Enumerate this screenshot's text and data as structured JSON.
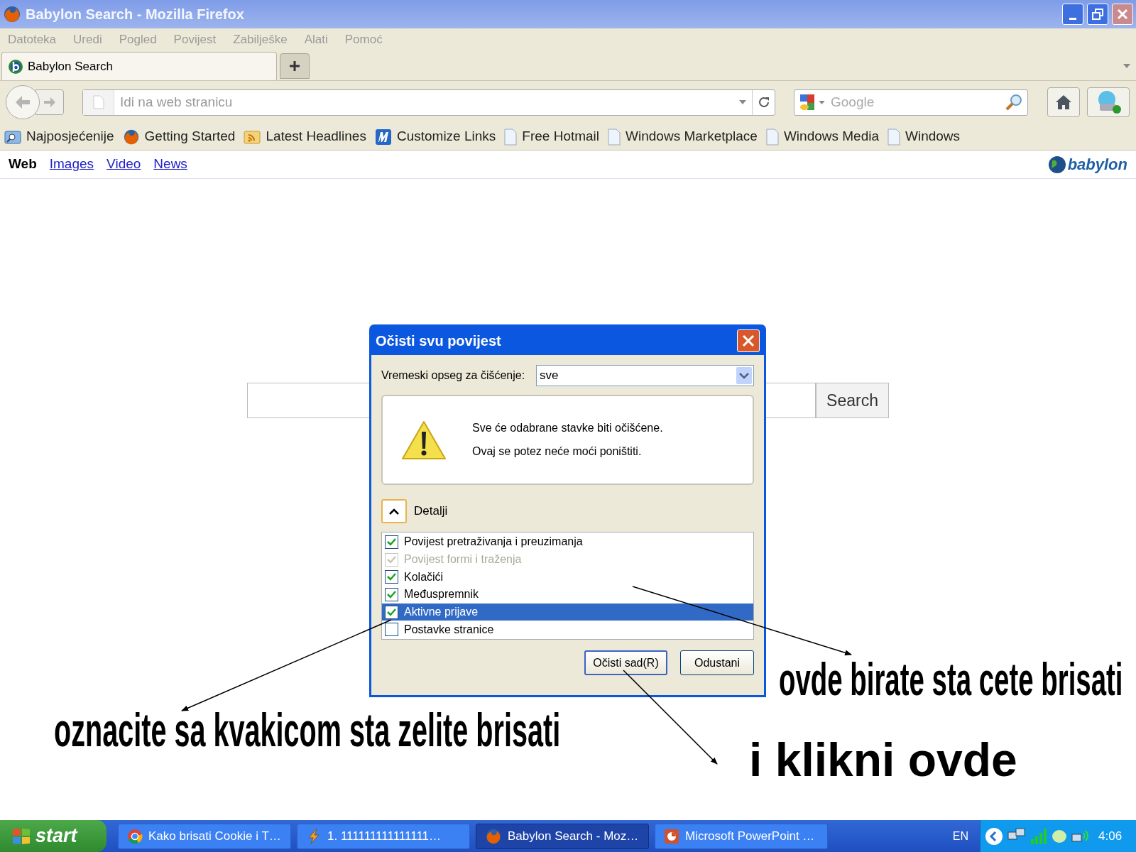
{
  "window": {
    "title": "Babylon Search - Mozilla Firefox"
  },
  "menu": [
    "Datoteka",
    "Uredi",
    "Pogled",
    "Povijest",
    "Zabilješke",
    "Alati",
    "Pomoć"
  ],
  "tabs": [
    {
      "label": "Babylon Search",
      "selected": true
    }
  ],
  "toolbar": {
    "address_placeholder": "Idi na web stranicu",
    "search_placeholder": "Google"
  },
  "bookmarks": [
    {
      "label": "Najposjećenije",
      "kind": "folder"
    },
    {
      "label": "Getting Started",
      "kind": "firefox"
    },
    {
      "label": "Latest Headlines",
      "kind": "feed"
    },
    {
      "label": "Customize Links",
      "kind": "m"
    },
    {
      "label": "Free Hotmail",
      "kind": "page"
    },
    {
      "label": "Windows Marketplace",
      "kind": "page"
    },
    {
      "label": "Windows Media",
      "kind": "page"
    },
    {
      "label": "Windows",
      "kind": "page"
    }
  ],
  "page_nav": [
    {
      "label": "Web",
      "selected": true
    },
    {
      "label": "Images",
      "selected": false
    },
    {
      "label": "Video",
      "selected": false
    },
    {
      "label": "News",
      "selected": false
    }
  ],
  "logo": "babylon",
  "search": {
    "button": "Search"
  },
  "dialog": {
    "title": "Očisti svu povijest",
    "range_label": "Vremeski opseg za čišćenje:",
    "range_value": "sve",
    "warning": [
      "Sve će odabrane stavke biti očišćene.",
      "Ovaj se potez neće moći poništiti."
    ],
    "details_label": "Detalji",
    "expanded": true,
    "items": [
      {
        "label": "Povijest pretraživanja i preuzimanja",
        "checked": true,
        "disabled": false,
        "selected": false
      },
      {
        "label": "Povijest formi i traženja",
        "checked": true,
        "disabled": true,
        "selected": false
      },
      {
        "label": "Kolačići",
        "checked": true,
        "disabled": false,
        "selected": false
      },
      {
        "label": "Međuspremnik",
        "checked": true,
        "disabled": false,
        "selected": false
      },
      {
        "label": "Aktivne prijave",
        "checked": true,
        "disabled": false,
        "selected": true
      },
      {
        "label": "Postavke stranice",
        "checked": false,
        "disabled": false,
        "selected": false
      }
    ],
    "buttons": [
      "Očisti sad(R)",
      "Odustani"
    ]
  },
  "annotations": [
    "ovde birate sta cete brisati",
    "oznacite sa kvakicom sta zelite brisati",
    "i klikni ovde"
  ],
  "taskbar": {
    "start": "start",
    "items": [
      {
        "label": "Kako brisati Cookie i T…",
        "kind": "chrome",
        "selected": false
      },
      {
        "label": "1. 111111111111111…",
        "kind": "winamp",
        "selected": false
      },
      {
        "label": "Babylon Search - Moz…",
        "kind": "firefox",
        "selected": true
      },
      {
        "label": "Microsoft PowerPoint …",
        "kind": "powerpoint",
        "selected": false
      }
    ],
    "language": "EN",
    "clock": "4:06"
  }
}
